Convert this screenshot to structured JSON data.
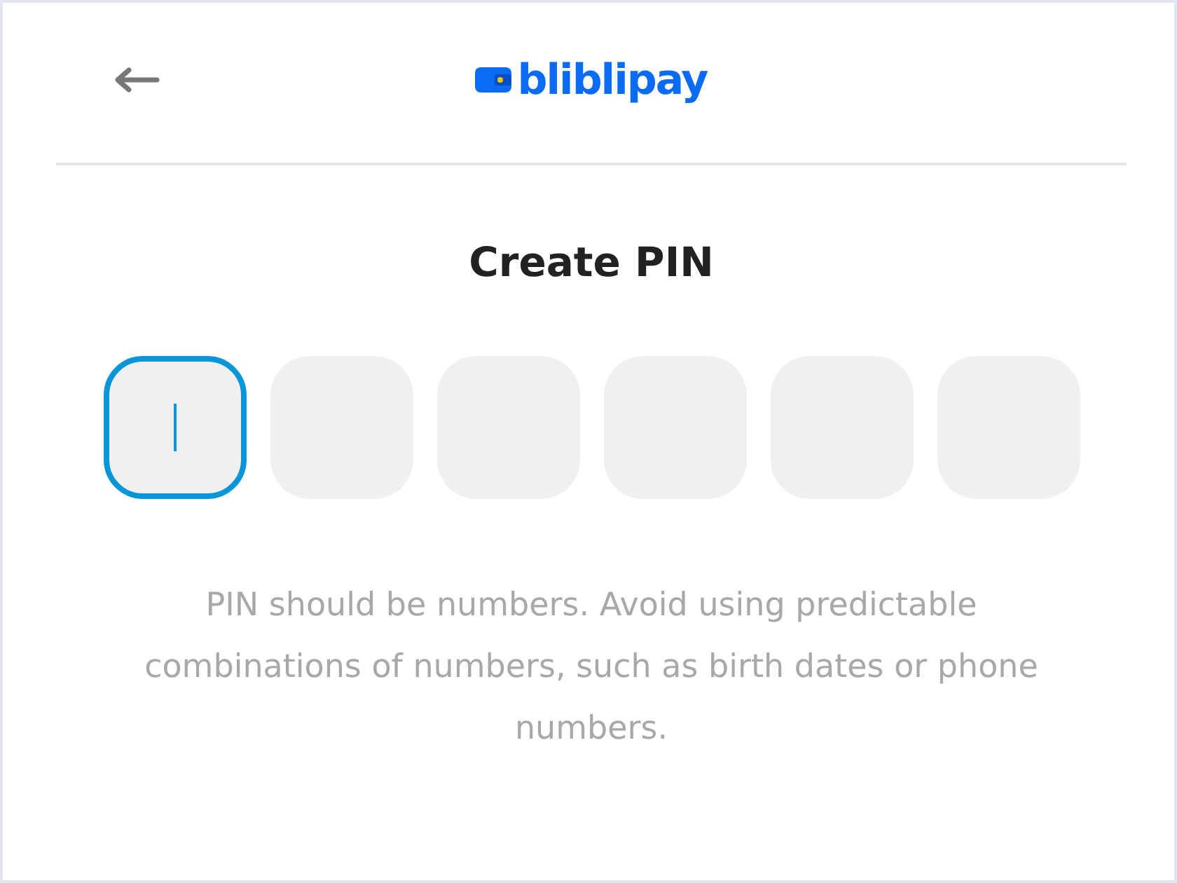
{
  "header": {
    "logo_text": "bliblipay"
  },
  "title": "Create PIN",
  "pin_boxes": [
    {
      "focused": true
    },
    {
      "focused": false
    },
    {
      "focused": false
    },
    {
      "focused": false
    },
    {
      "focused": false
    },
    {
      "focused": false
    }
  ],
  "hint": "PIN should be numbers. Avoid using predictable combinations of numbers, such as birth dates or phone numbers."
}
